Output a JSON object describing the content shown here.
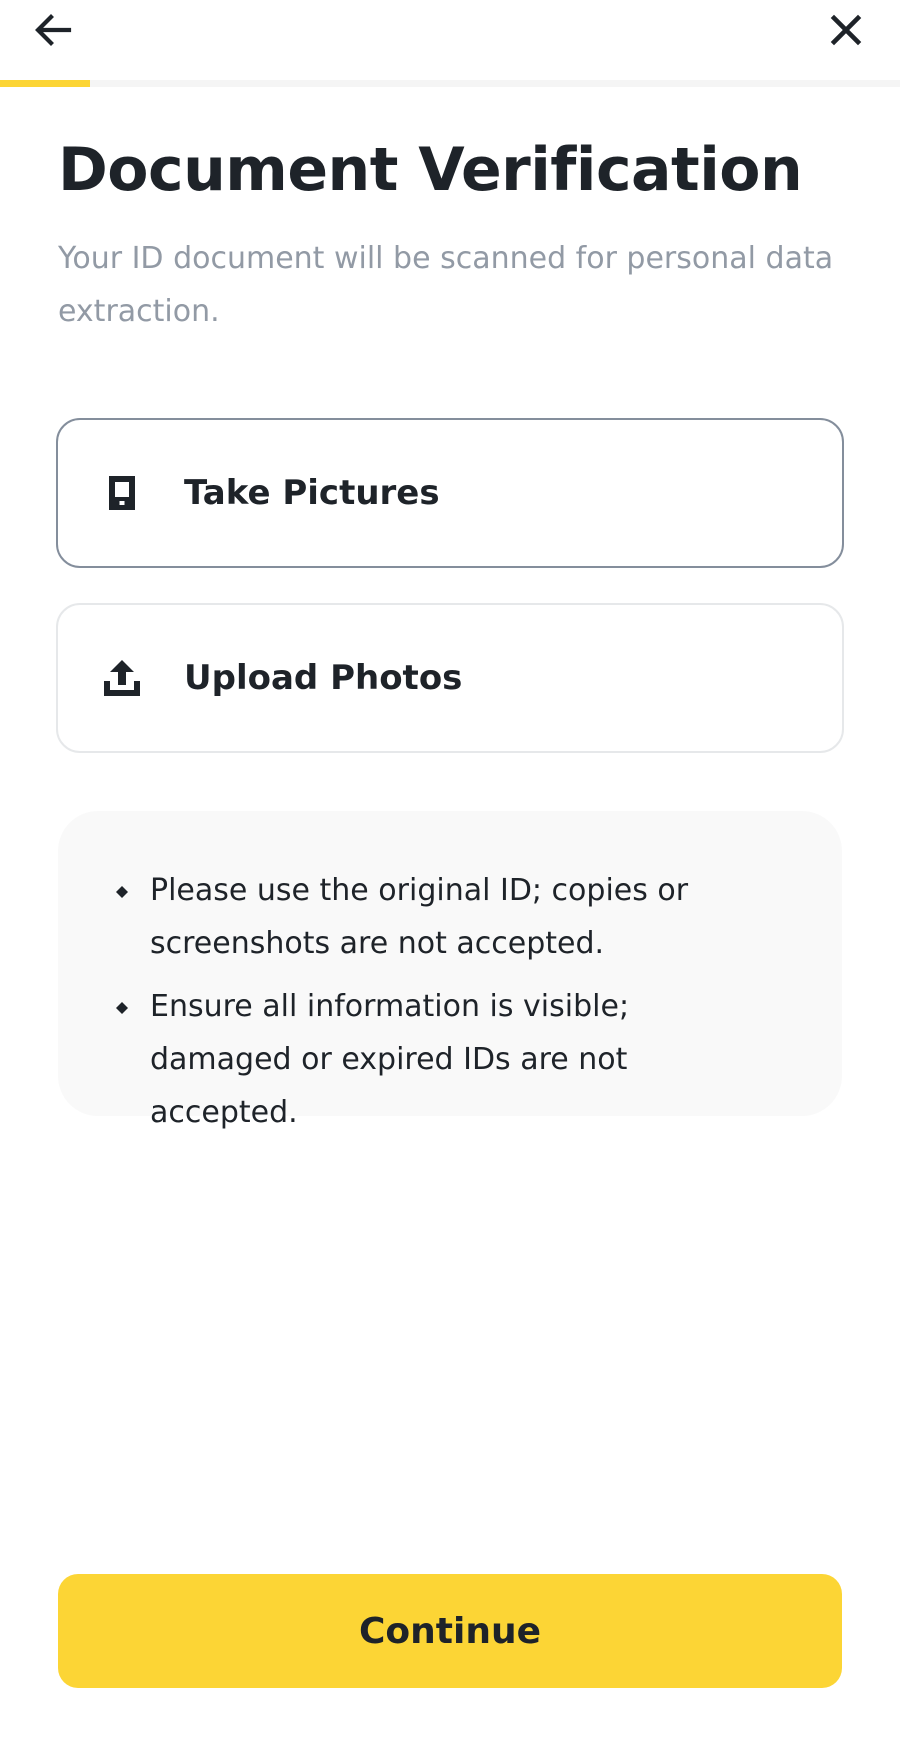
{
  "header": {
    "back_icon": "arrow-left-icon",
    "close_icon": "close-icon",
    "progress": 0.1,
    "accent_color": "#fcd535"
  },
  "page": {
    "title": "Document Verification",
    "subtitle": "Your ID document will be scanned for personal data extraction."
  },
  "options": [
    {
      "label": "Take Pictures",
      "icon": "phone-camera-icon",
      "selected": true
    },
    {
      "label": "Upload Photos",
      "icon": "upload-icon",
      "selected": false
    }
  ],
  "notes": [
    "Please use the original ID; copies or screenshots are not accepted.",
    "Ensure all information is visible; damaged or expired IDs are not accepted."
  ],
  "footer": {
    "continue_label": "Continue",
    "button_color": "#fcd535"
  }
}
